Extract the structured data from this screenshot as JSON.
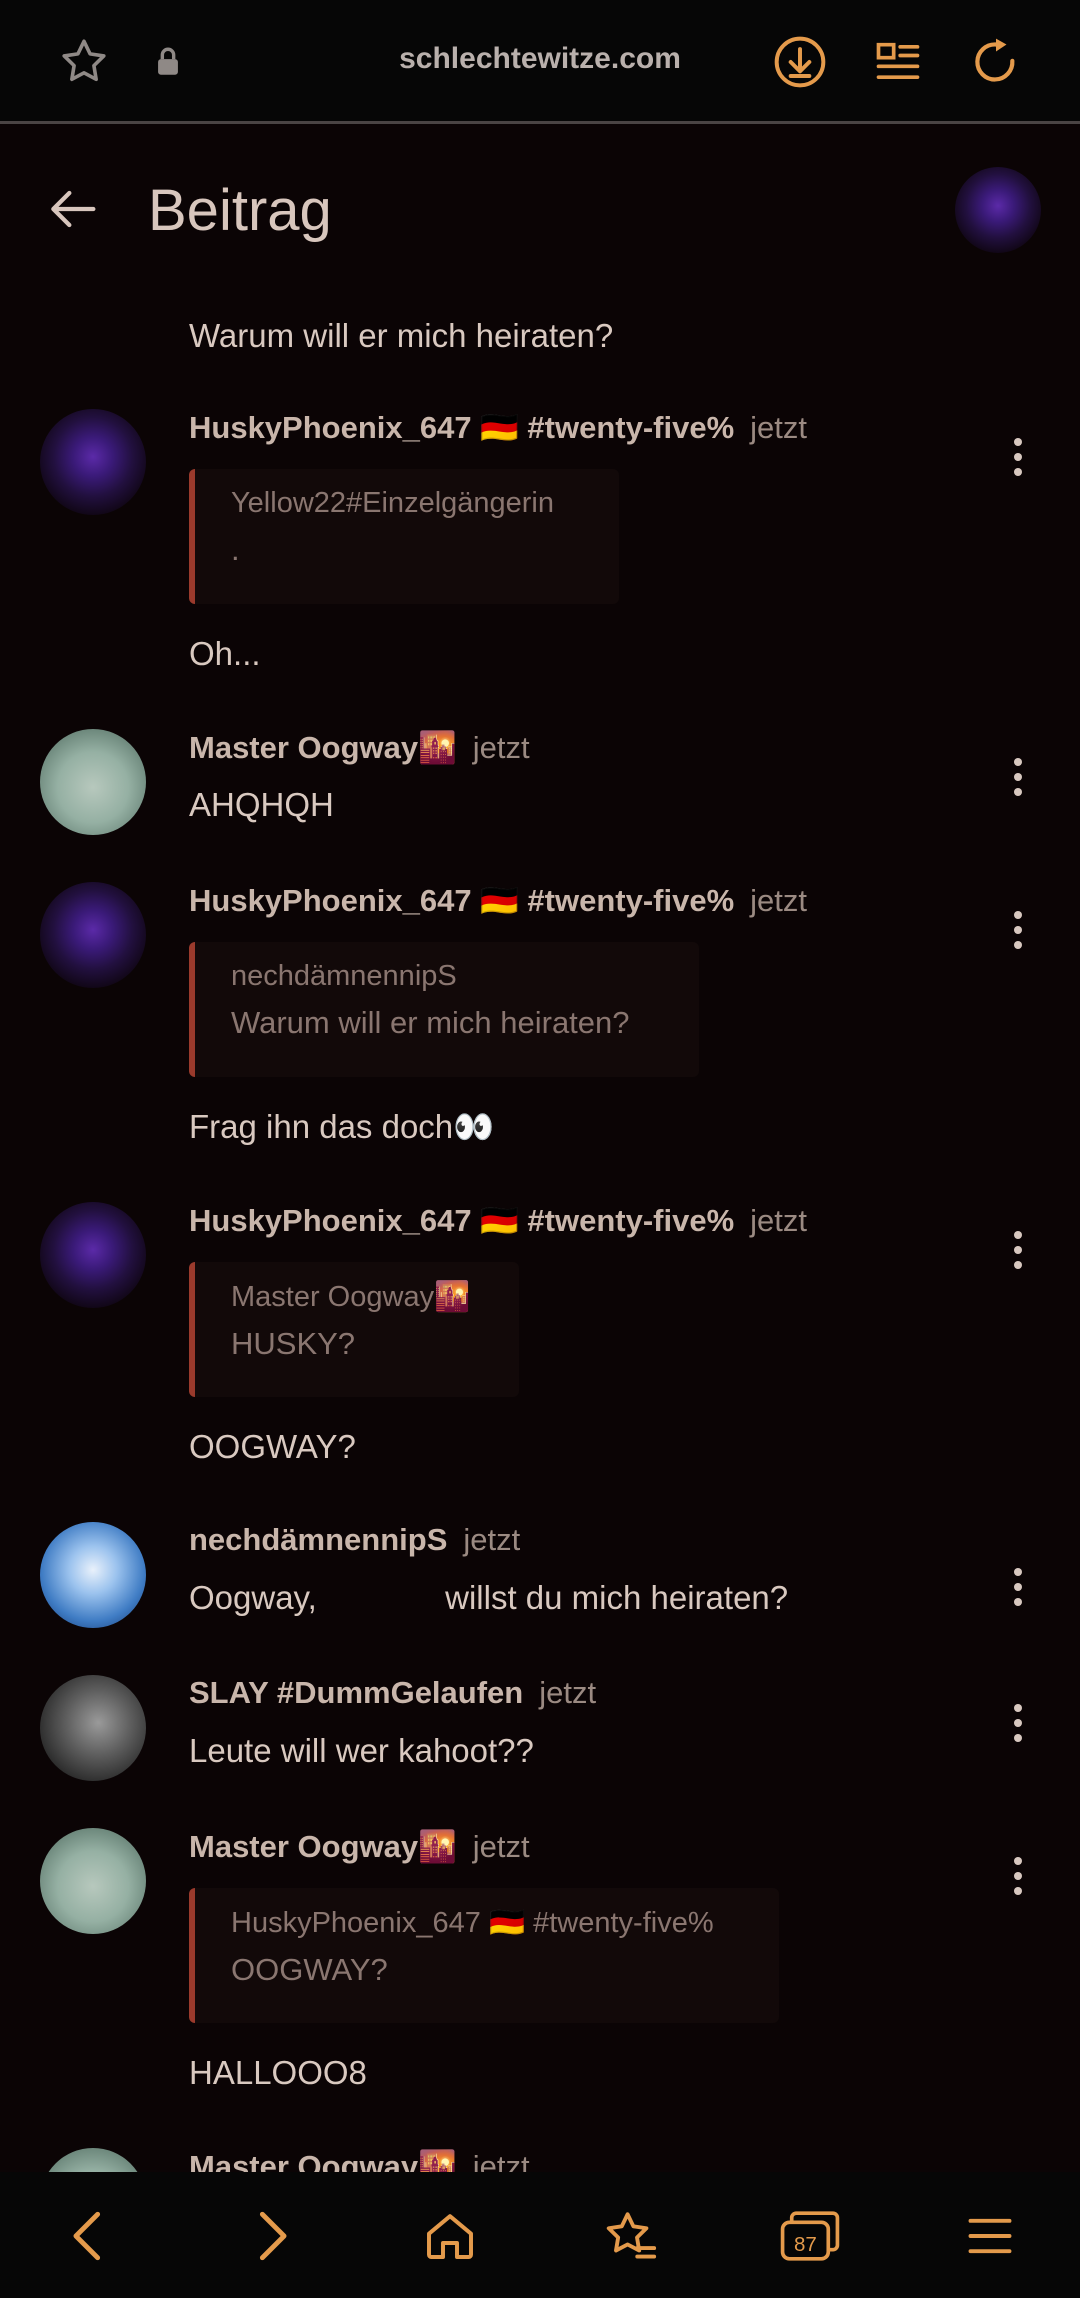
{
  "browser": {
    "url": "schlechtewitze.com",
    "tab_count": "87",
    "accent": "#e49a4b"
  },
  "header": {
    "title": "Beitrag"
  },
  "feed": {
    "top_text": "Warum will er mich heiraten?",
    "messages": [
      {
        "user": "HuskyPhoenix_647 🇩🇪 #twenty-five%",
        "time": "jetzt",
        "quote_user": "Yellow22#Einzelgängerin",
        "quote_text": ".",
        "text": "Oh..."
      },
      {
        "user": "Master Oogway🌇",
        "time": "jetzt",
        "text": "AHQHQH"
      },
      {
        "user": "HuskyPhoenix_647 🇩🇪 #twenty-five%",
        "time": "jetzt",
        "quote_user": "nechdämnennipS",
        "quote_text": "Warum will er mich heiraten?",
        "text": "Frag ihn das doch👀"
      },
      {
        "user": "HuskyPhoenix_647 🇩🇪 #twenty-five%",
        "time": "jetzt",
        "quote_user": "Master Oogway🌇",
        "quote_text": "HUSKY?",
        "text": "OOGWAY?"
      },
      {
        "user": "nechdämnennipS",
        "time": "jetzt",
        "text": "Oogway,              willst du mich heiraten?"
      },
      {
        "user": "SLAY #DummGelaufen",
        "time": "jetzt",
        "text": "Leute will wer kahoot??"
      },
      {
        "user": "Master Oogway🌇",
        "time": "jetzt",
        "quote_user": "HuskyPhoenix_647 🇩🇪 #twenty-five%",
        "quote_text": "OOGWAY?",
        "text": "HALLOOO8"
      },
      {
        "user": "Master Oogway🌇",
        "time": "jetzt"
      }
    ]
  },
  "icons": {
    "star": "star-icon",
    "lock": "lock-icon",
    "download": "download-icon",
    "reader": "reader-mode-icon",
    "reload": "reload-icon",
    "back": "arrow-back-icon",
    "nav_back": "chevron-left-icon",
    "nav_forward": "chevron-right-icon",
    "home": "home-icon",
    "bookmarks": "star-list-icon",
    "tabs": "tabs-icon",
    "menu": "hamburger-menu-icon"
  }
}
